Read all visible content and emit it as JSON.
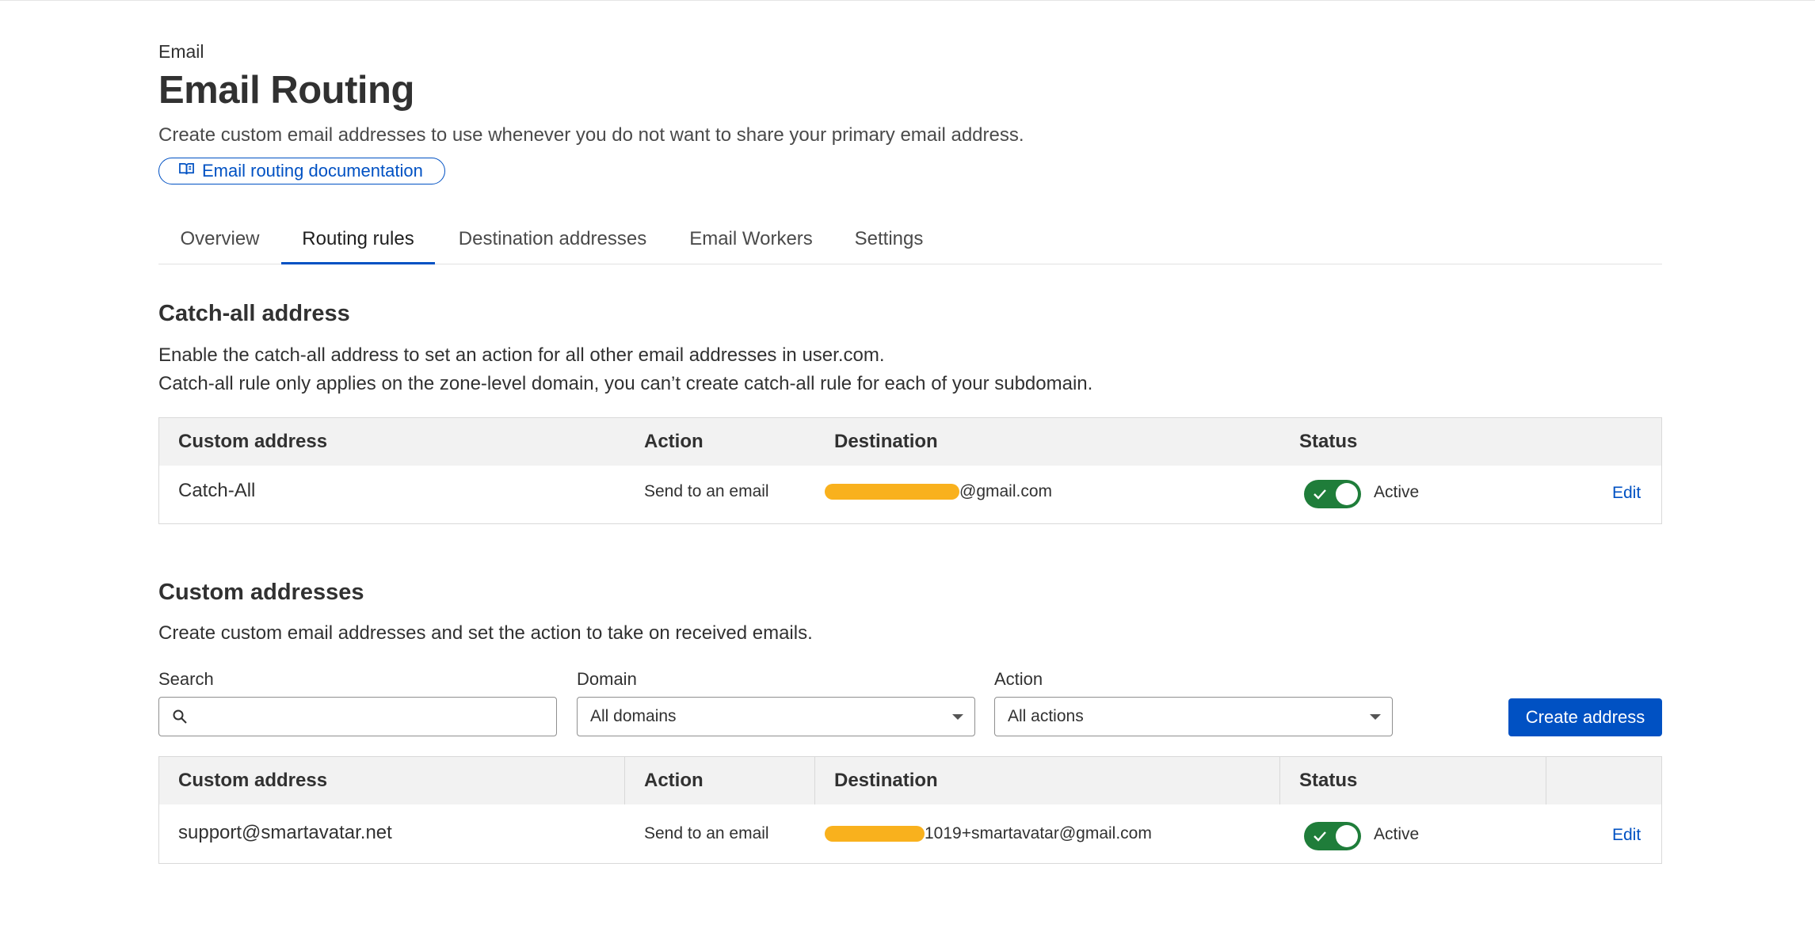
{
  "header": {
    "breadcrumb": "Email",
    "title": "Email Routing",
    "subtitle": "Create custom email addresses to use whenever you do not want to share your primary email address.",
    "doc_link": "Email routing documentation"
  },
  "tabs": [
    {
      "label": "Overview",
      "active": false
    },
    {
      "label": "Routing rules",
      "active": true
    },
    {
      "label": "Destination addresses",
      "active": false
    },
    {
      "label": "Email Workers",
      "active": false
    },
    {
      "label": "Settings",
      "active": false
    }
  ],
  "catch_all": {
    "title": "Catch-all address",
    "desc_line1": "Enable the catch-all address to set an action for all other email addresses in user.com.",
    "desc_line2": "Catch-all rule only applies on the zone-level domain, you can’t create catch-all rule for each of your subdomain.",
    "columns": [
      "Custom address",
      "Action",
      "Destination",
      "Status"
    ],
    "row": {
      "address": "Catch-All",
      "action": "Send to an email",
      "destination_visible": "@gmail.com",
      "status": "Active",
      "toggle_on": true,
      "edit_label": "Edit"
    }
  },
  "custom": {
    "title": "Custom addresses",
    "desc": "Create custom email addresses and set the action to take on received emails.",
    "filters": {
      "search_label": "Search",
      "search_placeholder": "",
      "domain_label": "Domain",
      "domain_value": "All domains",
      "action_label": "Action",
      "action_value": "All actions"
    },
    "create_button": "Create address",
    "columns": [
      "Custom address",
      "Action",
      "Destination",
      "Status"
    ],
    "rows": [
      {
        "address": "support@smartavatar.net",
        "action": "Send to an email",
        "destination_visible": "1019+smartavatar@gmail.com",
        "status": "Active",
        "toggle_on": true,
        "edit_label": "Edit"
      }
    ]
  },
  "colors": {
    "accent": "#0051c3",
    "toggle_on": "#1f7d3a",
    "redaction": "#f9b11d",
    "table_header_bg": "#f2f2f2"
  }
}
